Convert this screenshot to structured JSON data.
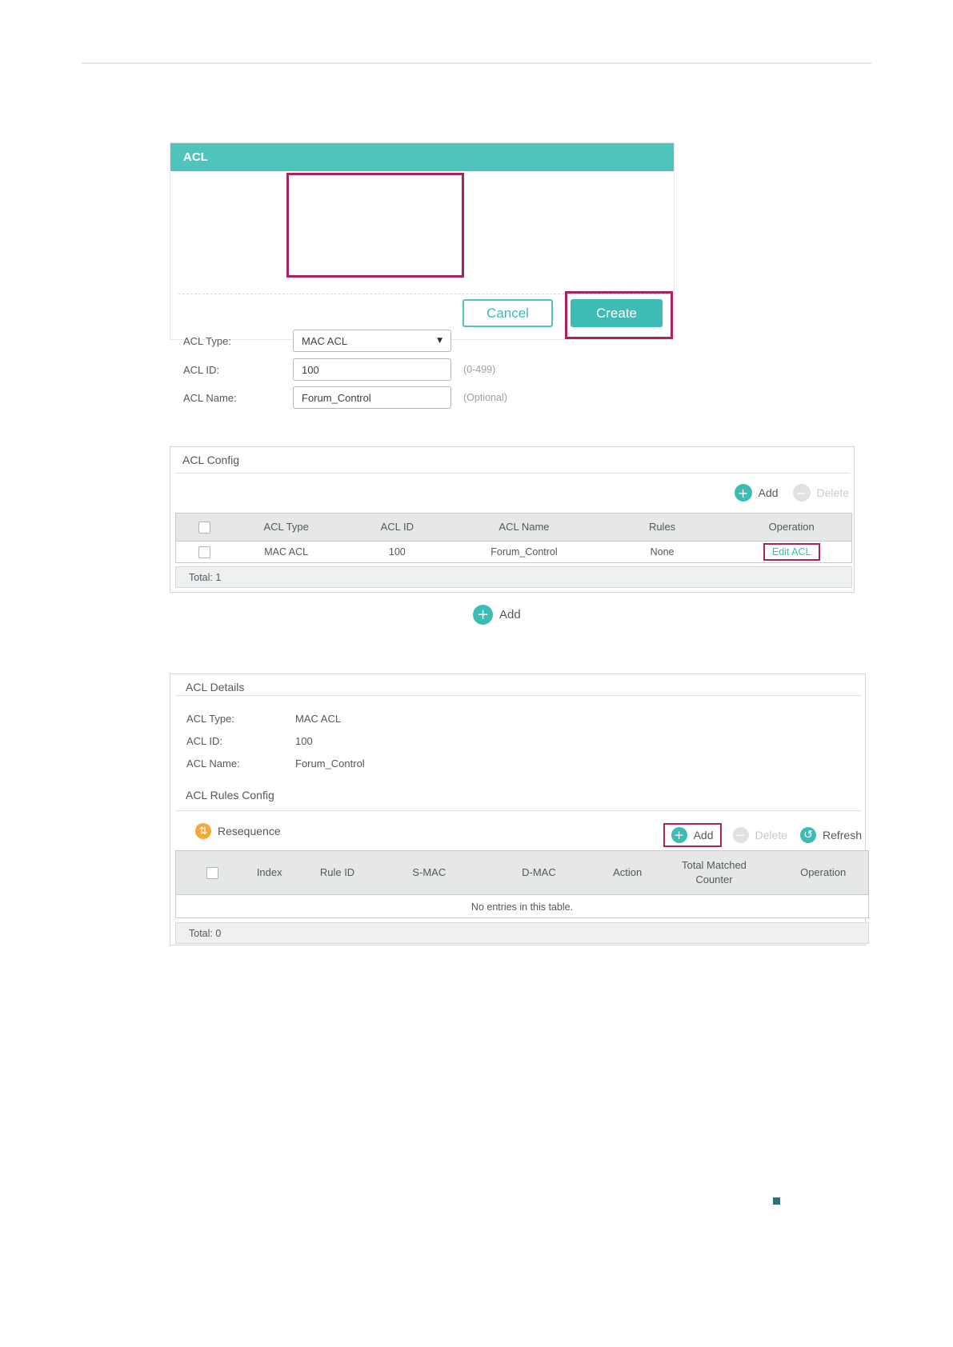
{
  "colors": {
    "accent_teal": "#4ec4bc",
    "button_teal": "#3cbcb4",
    "highlight_magenta": "#a8235f",
    "resequence_orange": "#f2a93b",
    "footer_marker": "#2e6f80"
  },
  "acl_form": {
    "title": "ACL",
    "acl_type": {
      "label": "ACL Type:",
      "value": "MAC ACL"
    },
    "acl_id": {
      "label": "ACL ID:",
      "value": "100",
      "hint": "(0-499)"
    },
    "acl_name": {
      "label": "ACL Name:",
      "value": "Forum_Control",
      "hint": "(Optional)"
    },
    "cancel_label": "Cancel",
    "create_label": "Create"
  },
  "acl_config": {
    "title": "ACL Config",
    "add_label": "Add",
    "delete_label": "Delete",
    "headers": {
      "acl_type": "ACL Type",
      "acl_id": "ACL ID",
      "acl_name": "ACL Name",
      "rules": "Rules",
      "operation": "Operation"
    },
    "row": {
      "acl_type": "MAC ACL",
      "acl_id": "100",
      "acl_name": "Forum_Control",
      "rules": "None",
      "operation": "Edit ACL"
    },
    "total": "Total: 1"
  },
  "add_step": {
    "label": "Add"
  },
  "acl_details": {
    "title": "ACL Details",
    "acl_type": {
      "label": "ACL Type:",
      "value": "MAC ACL"
    },
    "acl_id": {
      "label": "ACL ID:",
      "value": "100"
    },
    "acl_name": {
      "label": "ACL Name:",
      "value": "Forum_Control"
    },
    "rules_title": "ACL Rules Config",
    "resequence_label": "Resequence",
    "add_label": "Add",
    "delete_label": "Delete",
    "refresh_label": "Refresh",
    "headers": {
      "index": "Index",
      "rule_id": "Rule ID",
      "smac": "S-MAC",
      "dmac": "D-MAC",
      "action": "Action",
      "total_matched_counter": "Total Matched Counter",
      "operation": "Operation"
    },
    "empty_text": "No entries in this table.",
    "total": "Total: 0"
  }
}
